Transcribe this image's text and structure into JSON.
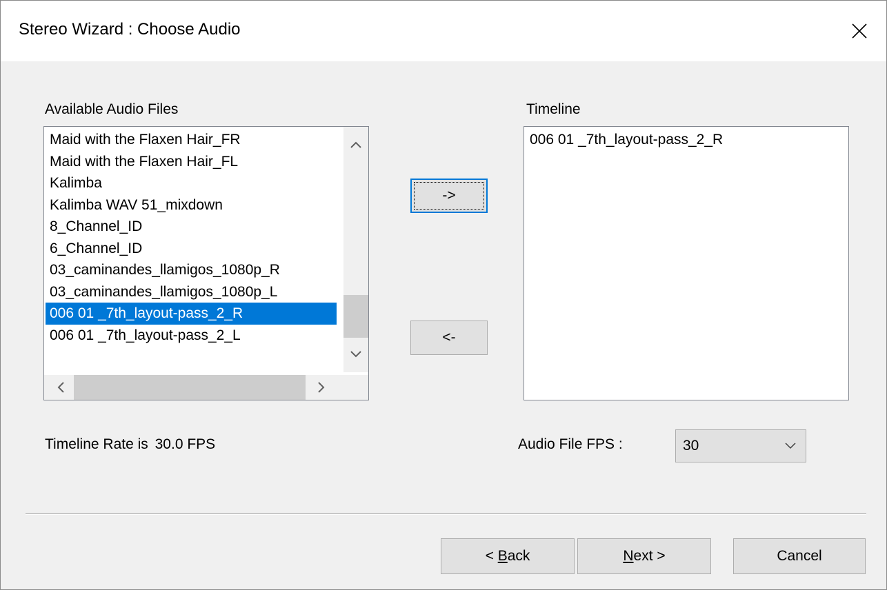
{
  "window": {
    "title": "Stereo Wizard : Choose Audio",
    "close_icon": "close-icon"
  },
  "available": {
    "label": "Available Audio Files",
    "items": [
      "Maid with the Flaxen Hair_FR",
      "Maid with the Flaxen Hair_FL",
      "Kalimba",
      "Kalimba WAV 51_mixdown",
      "8_Channel_ID",
      "6_Channel_ID",
      "03_caminandes_llamigos_1080p_R",
      "03_caminandes_llamigos_1080p_L",
      "006 01 _7th_layout-pass_2_R",
      "006 01 _7th_layout-pass_2_L"
    ],
    "selected_index": 8
  },
  "timeline": {
    "label": "Timeline",
    "items": [
      "006 01 _7th_layout-pass_2_R"
    ]
  },
  "buttons": {
    "add": "->",
    "remove": "<-",
    "back_prefix": "< ",
    "back_mnemonic": "B",
    "back_rest": "ack",
    "next_mnemonic": "N",
    "next_rest": "ext >",
    "cancel": "Cancel"
  },
  "status": {
    "rate_label": "Timeline Rate is",
    "rate_value": "30.0",
    "rate_unit": "FPS"
  },
  "fps": {
    "label": "Audio File FPS :",
    "value": "30"
  },
  "colors": {
    "selection": "#0078d7",
    "dialog_bg": "#f0f0f0"
  }
}
